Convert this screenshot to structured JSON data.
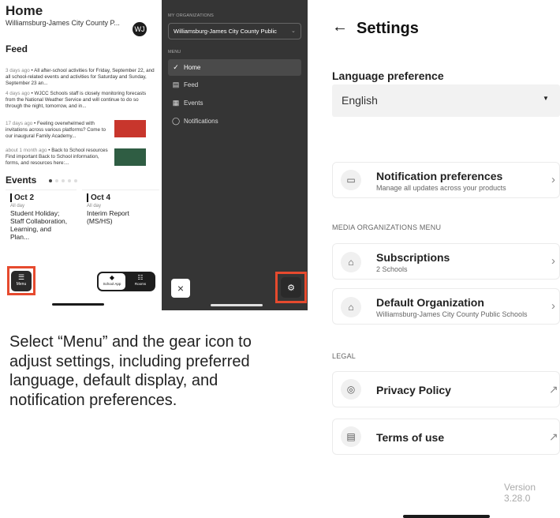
{
  "home": {
    "title": "Home",
    "org": "Williamsburg-James City County P...",
    "logo_text": "WJ",
    "feed_title": "Feed",
    "feed": [
      {
        "ago": "3 days ago",
        "text": "All after-school activities for Friday, September 22, and all school-related events and activities for Saturday and Sunday, September 23 an..."
      },
      {
        "ago": "4 days ago",
        "text": "WJCC Schools staff is closely monitoring forecasts from the National Weather Service and will continue to do so through the night, tomorrow, and in..."
      },
      {
        "ago": "17 days ago",
        "text": "Feeling overwhelmed with invitations across various platforms? Come to our inaugural Family Academy..."
      },
      {
        "ago": "about 1 month ago",
        "text": "Back to School resources Find important Back to School information, forms, and resources here:..."
      }
    ],
    "events_title": "Events",
    "events": [
      {
        "date": "Oct 2",
        "all_day": "All day",
        "text": "Student Holiday; Staff Collaboration, Learning, and Plan..."
      },
      {
        "date": "Oct 4",
        "all_day": "All day",
        "text": "Interim Report (MS/HS)"
      }
    ],
    "menu_label": "Menu",
    "seg": [
      {
        "label": "School App",
        "icon": "◆"
      },
      {
        "label": "Rooms",
        "icon": "☷"
      }
    ]
  },
  "menu": {
    "orgs_header": "MY ORGANIZATIONS",
    "org_selected": "Williamsburg-James City County Public",
    "menu_header": "MENU",
    "items": [
      {
        "label": "Home",
        "icon": "check-icon"
      },
      {
        "label": "Feed",
        "icon": "feed-icon"
      },
      {
        "label": "Events",
        "icon": "calendar-icon"
      },
      {
        "label": "Notifications",
        "icon": "bell-icon"
      }
    ]
  },
  "caption": "Select “Menu” and the gear icon to adjust settings, including preferred language, default display, and notification preferences.",
  "settings": {
    "back": "←",
    "title": "Settings",
    "language_header": "Language preference",
    "language_value": "English",
    "notif_title": "Notification preferences",
    "notif_sub": "Manage all updates across your products",
    "media_header": "MEDIA ORGANIZATIONS MENU",
    "subs_title": "Subscriptions",
    "subs_sub": "2 Schools",
    "default_title": "Default Organization",
    "default_sub": "Williamsburg-James City County Public Schools",
    "legal_header": "LEGAL",
    "privacy": "Privacy Policy",
    "terms": "Terms of use",
    "version": "Version 3.28.0"
  },
  "colors": {
    "highlight": "#e64a2e",
    "menu_bg": "#353535"
  }
}
